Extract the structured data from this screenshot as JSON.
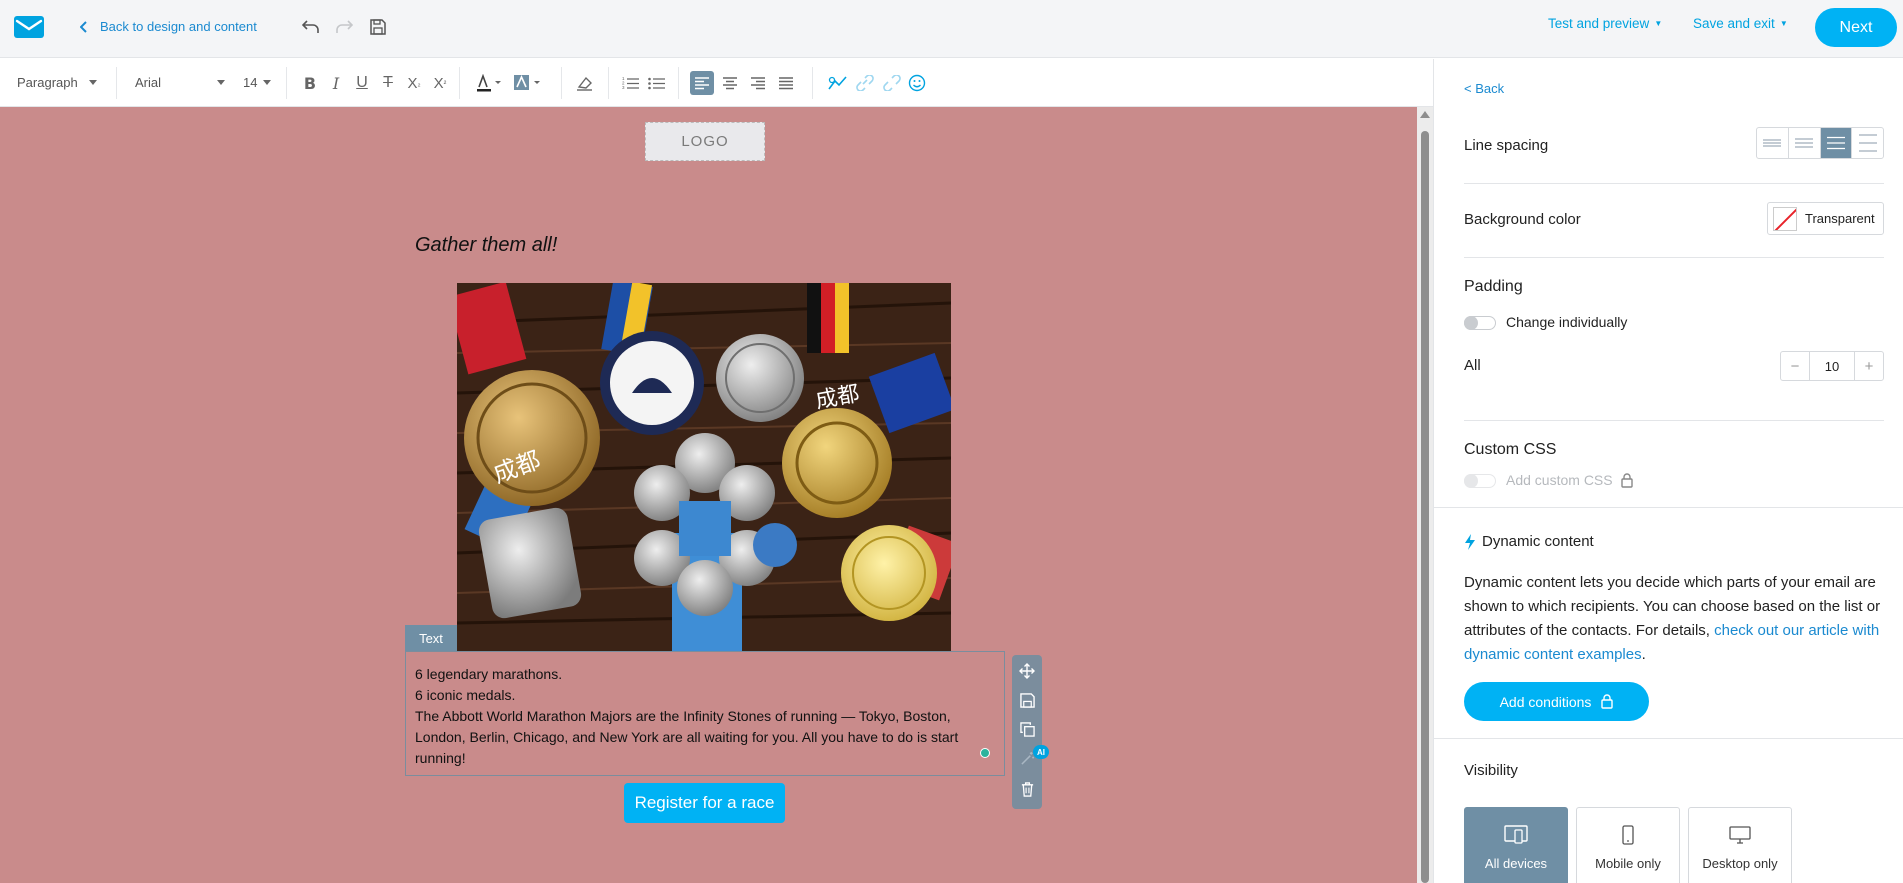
{
  "topbar": {
    "back_label": "Back to design and content",
    "test_preview": "Test and preview",
    "save_exit": "Save and exit",
    "next": "Next"
  },
  "toolbar": {
    "block_format": "Paragraph",
    "font_family": "Arial",
    "font_size": "14"
  },
  "canvas": {
    "background": "#c98b8b",
    "logo_placeholder": "LOGO",
    "heading": "Gather them all!",
    "text_tag": "Text",
    "text_lines": [
      "6 legendary marathons.",
      "6 iconic medals.",
      "The Abbott World Marathon Majors are the Infinity Stones of running — Tokyo, Boston, London, Berlin, Chicago, and New York are all waiting for you. All you have to do is start running!"
    ],
    "ai_badge": "AI",
    "button_label": "Register for a race"
  },
  "panel": {
    "back": "< Back",
    "line_spacing_label": "Line spacing",
    "background_color_label": "Background color",
    "background_color_value": "Transparent",
    "padding_title": "Padding",
    "change_individually": "Change individually",
    "all_label": "All",
    "padding_value": "10",
    "custom_css_title": "Custom CSS",
    "add_custom_css": "Add custom CSS",
    "dynamic_title": "Dynamic content",
    "dynamic_desc": "Dynamic content lets you decide which parts of your email are shown to which recipients. You can choose based on the list or attributes of the contacts. For details, ",
    "dynamic_link": "check out our article with dynamic content examples",
    "dynamic_end": ".",
    "add_conditions": "Add conditions",
    "visibility_title": "Visibility",
    "visibility_options": [
      "All devices",
      "Mobile only",
      "Desktop only"
    ]
  },
  "colors": {
    "accent": "#00b2f4",
    "link": "#1b8ad0",
    "active_gray_blue": "#6f8fa5"
  }
}
